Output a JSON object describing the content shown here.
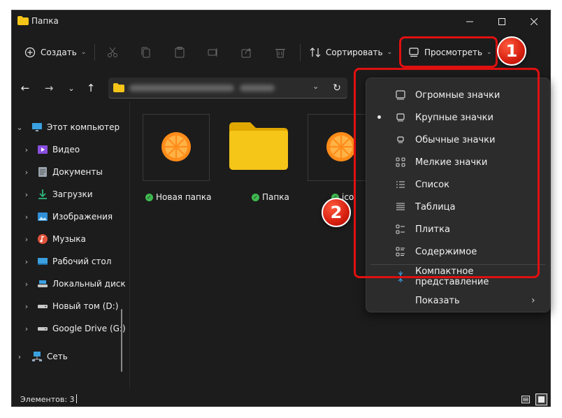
{
  "window": {
    "title": "Папка"
  },
  "toolbar": {
    "create_label": "Создать",
    "sort_label": "Сортировать",
    "view_label": "Просмотреть"
  },
  "sidebar": {
    "items": [
      {
        "label": "Этот компьютер",
        "icon": "computer-icon"
      },
      {
        "label": "Видео",
        "icon": "video-icon"
      },
      {
        "label": "Документы",
        "icon": "document-icon"
      },
      {
        "label": "Загрузки",
        "icon": "download-icon"
      },
      {
        "label": "Изображения",
        "icon": "image-icon"
      },
      {
        "label": "Музыка",
        "icon": "music-icon"
      },
      {
        "label": "Рабочий стол",
        "icon": "desktop-icon"
      },
      {
        "label": "Локальный диск",
        "icon": "drive-icon"
      },
      {
        "label": "Новый том (D:)",
        "icon": "drive-icon"
      },
      {
        "label": "Google Drive (G:)",
        "icon": "drive-icon"
      },
      {
        "label": "Сеть",
        "icon": "network-icon"
      }
    ]
  },
  "files": [
    {
      "name": "Новая папка",
      "type": "orange-thumbnail"
    },
    {
      "name": "Папка",
      "type": "folder"
    },
    {
      "name": "ico",
      "type": "orange-thumbnail"
    }
  ],
  "view_menu": {
    "items": [
      {
        "label": "Огромные значки",
        "icon": "extra-large-icons-icon",
        "selected": false
      },
      {
        "label": "Крупные значки",
        "icon": "large-icons-icon",
        "selected": true
      },
      {
        "label": "Обычные значки",
        "icon": "medium-icons-icon",
        "selected": false
      },
      {
        "label": "Мелкие значки",
        "icon": "small-icons-icon",
        "selected": false
      },
      {
        "label": "Список",
        "icon": "list-icon",
        "selected": false
      },
      {
        "label": "Таблица",
        "icon": "details-icon",
        "selected": false
      },
      {
        "label": "Плитка",
        "icon": "tiles-icon",
        "selected": false
      },
      {
        "label": "Содержимое",
        "icon": "content-icon",
        "selected": false
      }
    ],
    "compact_label": "Компактное представление",
    "show_label": "Показать"
  },
  "status": {
    "items_count": "Элементов: 3"
  },
  "annotations": {
    "badge1": "1",
    "badge2": "2"
  },
  "colors": {
    "accent": "#e01010",
    "folder": "#f5c518",
    "orange": "#ff8c1a",
    "ok": "#3fb950"
  }
}
